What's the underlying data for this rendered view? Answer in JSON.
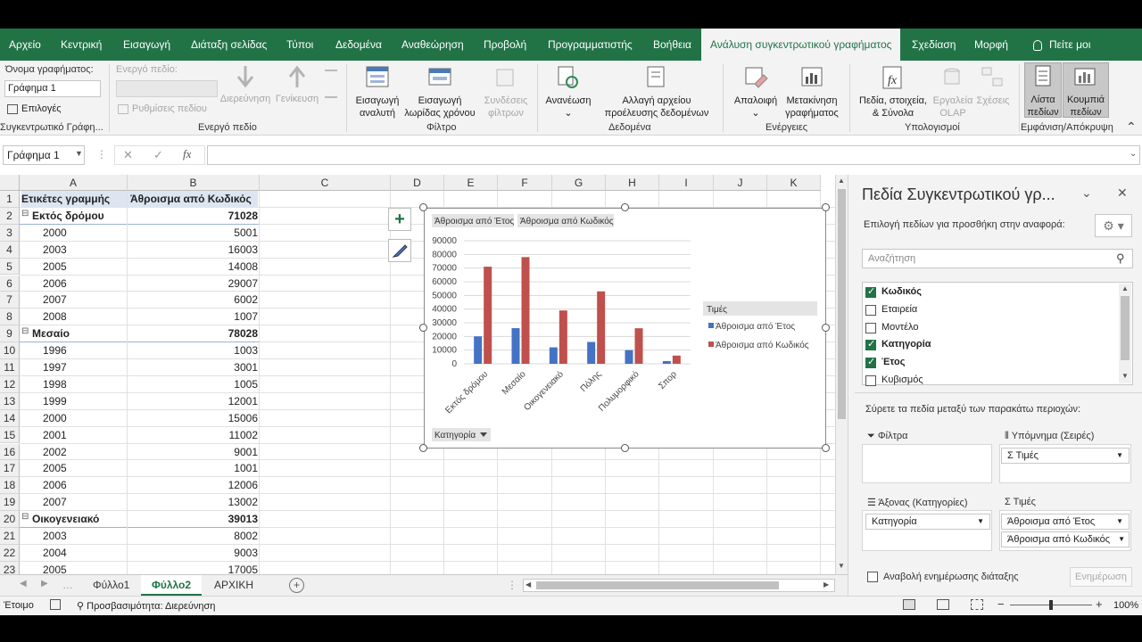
{
  "ribbon_tabs": [
    "Αρχείο",
    "Κεντρική",
    "Εισαγωγή",
    "Διάταξη σελίδας",
    "Τύποι",
    "Δεδομένα",
    "Αναθεώρηση",
    "Προβολή",
    "Προγραμματιστής",
    "Βοήθεια",
    "Ανάλυση συγκεντρωτικού γραφήματος",
    "Σχεδίαση",
    "Μορφή"
  ],
  "tell_me": "Πείτε μοι",
  "ribbon": {
    "chart_name_label": "Όνομα γραφήματος:",
    "chart_name_value": "Γράφημα 1",
    "options": "Επιλογές",
    "group_pivotchart": "Συγκεντρωτικό Γράφη...",
    "active_field_label": "Ενεργό πεδίο:",
    "drill_down": "Διερεύνηση",
    "drill_up": "Γενίκευση",
    "field_settings": "Ρυθμίσεις πεδίου",
    "group_active_field": "Ενεργό πεδίο",
    "insert_slicer": "Εισαγωγή αναλυτή",
    "insert_timeline": "Εισαγωγή λωρίδας χρόνου",
    "filter_connections": "Συνδέσεις φίλτρων",
    "group_filter": "Φίλτρο",
    "refresh": "Ανανέωση",
    "change_source": "Αλλαγή αρχείου προέλευσης δεδομένων",
    "group_data": "Δεδομένα",
    "clear": "Απαλοιφή",
    "move_chart": "Μετακίνηση γραφήματος",
    "group_actions": "Ενέργειες",
    "fields_items_sets": "Πεδία, στοιχεία, & Σύνολα",
    "olap_tools": "Εργαλεία OLAP",
    "relationships": "Σχέσεις",
    "group_calculations": "Υπολογισμοί",
    "field_list": "Λίστα πεδίων",
    "field_buttons": "Κουμπιά πεδίων",
    "group_show_hide": "Εμφάνιση/Απόκρυψη"
  },
  "formula_bar": {
    "name_box": "Γράφημα 1",
    "fx": "fx",
    "content": ""
  },
  "columns": [
    "A",
    "B",
    "C",
    "D",
    "E",
    "F",
    "G",
    "H",
    "I",
    "J",
    "K"
  ],
  "rows": [
    {
      "n": "1",
      "a": "Ετικέτες γραμμής",
      "b": "Άθροισμα από Κωδικός",
      "type": "header"
    },
    {
      "n": "2",
      "a": "Εκτός δρόμου",
      "b": "71028",
      "type": "group"
    },
    {
      "n": "3",
      "a": "2000",
      "b": "5001",
      "type": "item"
    },
    {
      "n": "4",
      "a": "2003",
      "b": "16003",
      "type": "item"
    },
    {
      "n": "5",
      "a": "2005",
      "b": "14008",
      "type": "item"
    },
    {
      "n": "6",
      "a": "2006",
      "b": "29007",
      "type": "item"
    },
    {
      "n": "7",
      "a": "2007",
      "b": "6002",
      "type": "item"
    },
    {
      "n": "8",
      "a": "2008",
      "b": "1007",
      "type": "item"
    },
    {
      "n": "9",
      "a": "Μεσαίο",
      "b": "78028",
      "type": "group"
    },
    {
      "n": "10",
      "a": "1996",
      "b": "1003",
      "type": "item"
    },
    {
      "n": "11",
      "a": "1997",
      "b": "3001",
      "type": "item"
    },
    {
      "n": "12",
      "a": "1998",
      "b": "1005",
      "type": "item"
    },
    {
      "n": "13",
      "a": "1999",
      "b": "12001",
      "type": "item"
    },
    {
      "n": "14",
      "a": "2000",
      "b": "15006",
      "type": "item"
    },
    {
      "n": "15",
      "a": "2001",
      "b": "11002",
      "type": "item"
    },
    {
      "n": "16",
      "a": "2002",
      "b": "9001",
      "type": "item"
    },
    {
      "n": "17",
      "a": "2005",
      "b": "1001",
      "type": "item"
    },
    {
      "n": "18",
      "a": "2006",
      "b": "12006",
      "type": "item"
    },
    {
      "n": "19",
      "a": "2007",
      "b": "13002",
      "type": "item"
    },
    {
      "n": "20",
      "a": "Οικογενειακό",
      "b": "39013",
      "type": "group"
    },
    {
      "n": "21",
      "a": "2003",
      "b": "8002",
      "type": "item"
    },
    {
      "n": "22",
      "a": "2004",
      "b": "9003",
      "type": "item"
    },
    {
      "n": "23",
      "a": "2005",
      "b": "17005",
      "type": "item"
    }
  ],
  "chart_data": {
    "type": "bar",
    "categories": [
      "Εκτός δρόμου",
      "Μεσαίο",
      "Οικογενειακό",
      "Πόλης",
      "Πολυμορφικό",
      "Σπορ"
    ],
    "series": [
      {
        "name": "Άθροισμα από Έτος",
        "values": [
          20061,
          26065,
          12030,
          16000,
          10000,
          2000
        ],
        "color": "#4472c4"
      },
      {
        "name": "Άθροισμα από Κωδικός",
        "values": [
          71028,
          78028,
          39013,
          53000,
          26000,
          6000
        ],
        "color": "#c0504d"
      }
    ],
    "yticks": [
      "90000",
      "80000",
      "70000",
      "60000",
      "50000",
      "40000",
      "30000",
      "20000",
      "10000",
      "0"
    ],
    "ylim": [
      0,
      90000
    ],
    "legend_title": "Τιμές",
    "legend_position": "right",
    "field_buttons": [
      "Άθροισμα από Έτος",
      "Άθροισμα από Κωδικός"
    ],
    "axis_field_button": "Κατηγορία",
    "grid": true
  },
  "sheets": [
    "Φύλλο1",
    "Φύλλο2",
    "ΑΡΧΙΚΗ"
  ],
  "active_sheet": 1,
  "status": {
    "ready": "Έτοιμο",
    "accessibility": "Προσβασιμότητα: Διερεύνηση",
    "zoom": "100%"
  },
  "pane": {
    "title": "Πεδία Συγκεντρωτικού γρ...",
    "subtitle": "Επιλογή πεδίων για προσθήκη στην αναφορά:",
    "search_placeholder": "Αναζήτηση",
    "fields": [
      {
        "name": "Κωδικός",
        "checked": true
      },
      {
        "name": "Εταιρεία",
        "checked": false
      },
      {
        "name": "Μοντέλο",
        "checked": false
      },
      {
        "name": "Κατηγορία",
        "checked": true
      },
      {
        "name": "Έτος",
        "checked": true
      },
      {
        "name": "Κυβισμός",
        "checked": false
      }
    ],
    "drag_text": "Σύρετε τα πεδία μεταξύ των παρακάτω περιοχών:",
    "filters_label": "Φίλτρα",
    "legend_label": "Υπόμνημα (Σειρές)",
    "legend_item": "Σ  Τιμές",
    "axis_label": "Άξονας (Κατηγορίες)",
    "axis_item": "Κατηγορία",
    "values_label": "Τιμές",
    "values_items": [
      "Άθροισμα από Έτος",
      "Άθροισμα από Κωδικός"
    ],
    "defer_label": "Αναβολή ενημέρωσης διάταξης",
    "update_button": "Ενημέρωση"
  }
}
